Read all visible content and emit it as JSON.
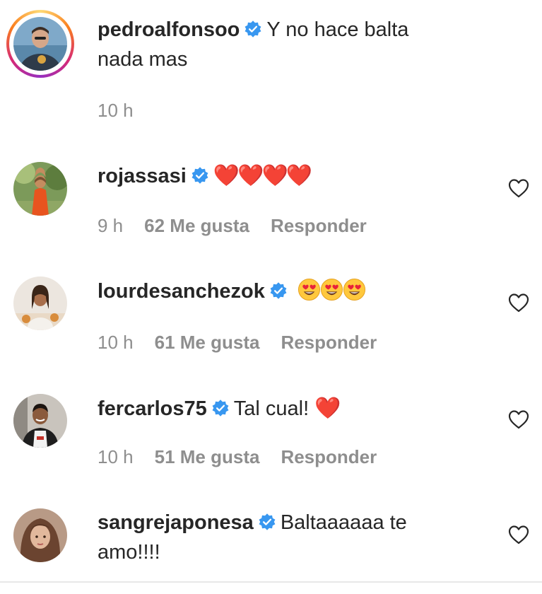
{
  "comments": [
    {
      "username": "pedroalfonsoo",
      "text_line1": "Y no hace balta",
      "text_line2": "nada mas",
      "time": "10 h",
      "avatar_icon": "person-avatar",
      "has_story_ring": true
    },
    {
      "username": "rojassasi",
      "emoji": "❤️❤️❤️❤️",
      "time": "9 h",
      "likes": "62 Me gusta",
      "reply": "Responder",
      "avatar_icon": "person-avatar"
    },
    {
      "username": "lourdesanchezok",
      "emoji": "😍😍😍",
      "time": "10 h",
      "likes": "61 Me gusta",
      "reply": "Responder",
      "avatar_icon": "person-avatar"
    },
    {
      "username": "fercarlos75",
      "text_line1": "Tal cual!",
      "emoji": "❤️",
      "time": "10 h",
      "likes": "51 Me gusta",
      "reply": "Responder",
      "avatar_icon": "person-avatar"
    },
    {
      "username": "sangrejaponesa",
      "text_line1": "Baltaaaaaa te",
      "text_line2": "amo!!!!",
      "avatar_icon": "person-avatar"
    }
  ],
  "colors": {
    "text": "#262626",
    "meta": "#8e8e8e",
    "verified": "#3897f0",
    "heart_emoji": "#e0252c"
  },
  "icons": {
    "verified": "verified-badge-icon",
    "like": "heart-outline-icon"
  }
}
